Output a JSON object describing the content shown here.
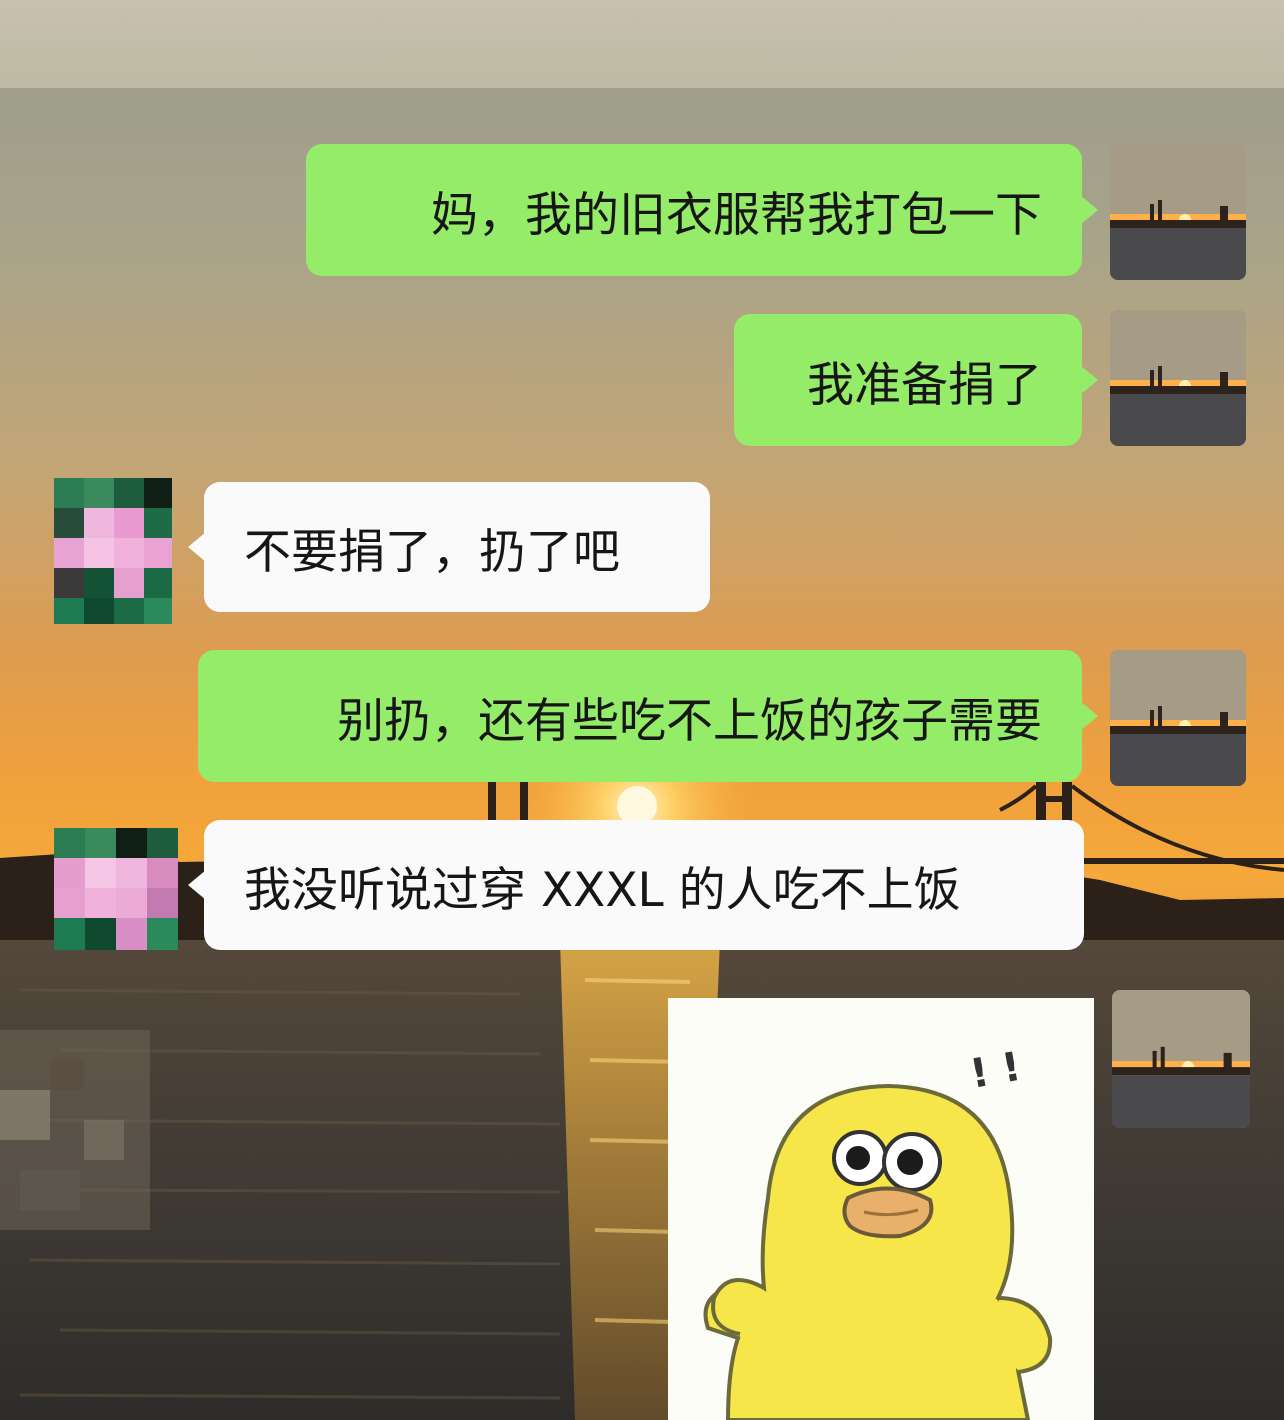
{
  "chat": {
    "messages": [
      {
        "sender": "me",
        "text": "妈，我的旧衣服帮我打包一下"
      },
      {
        "sender": "me",
        "text": "我准备捐了"
      },
      {
        "sender": "mom",
        "text": "不要捐了，扔了吧"
      },
      {
        "sender": "me",
        "text": "别扔，还有些吃不上饭的孩子需要"
      },
      {
        "sender": "mom",
        "text": "我没听说过穿 XXXL 的人吃不上饭"
      },
      {
        "sender": "me",
        "type": "sticker",
        "sticker": "yellow-duck-surprised",
        "sticker_text": "! !"
      }
    ]
  },
  "colors": {
    "sent_bubble": "#95ec69",
    "received_bubble": "#fafafa"
  }
}
